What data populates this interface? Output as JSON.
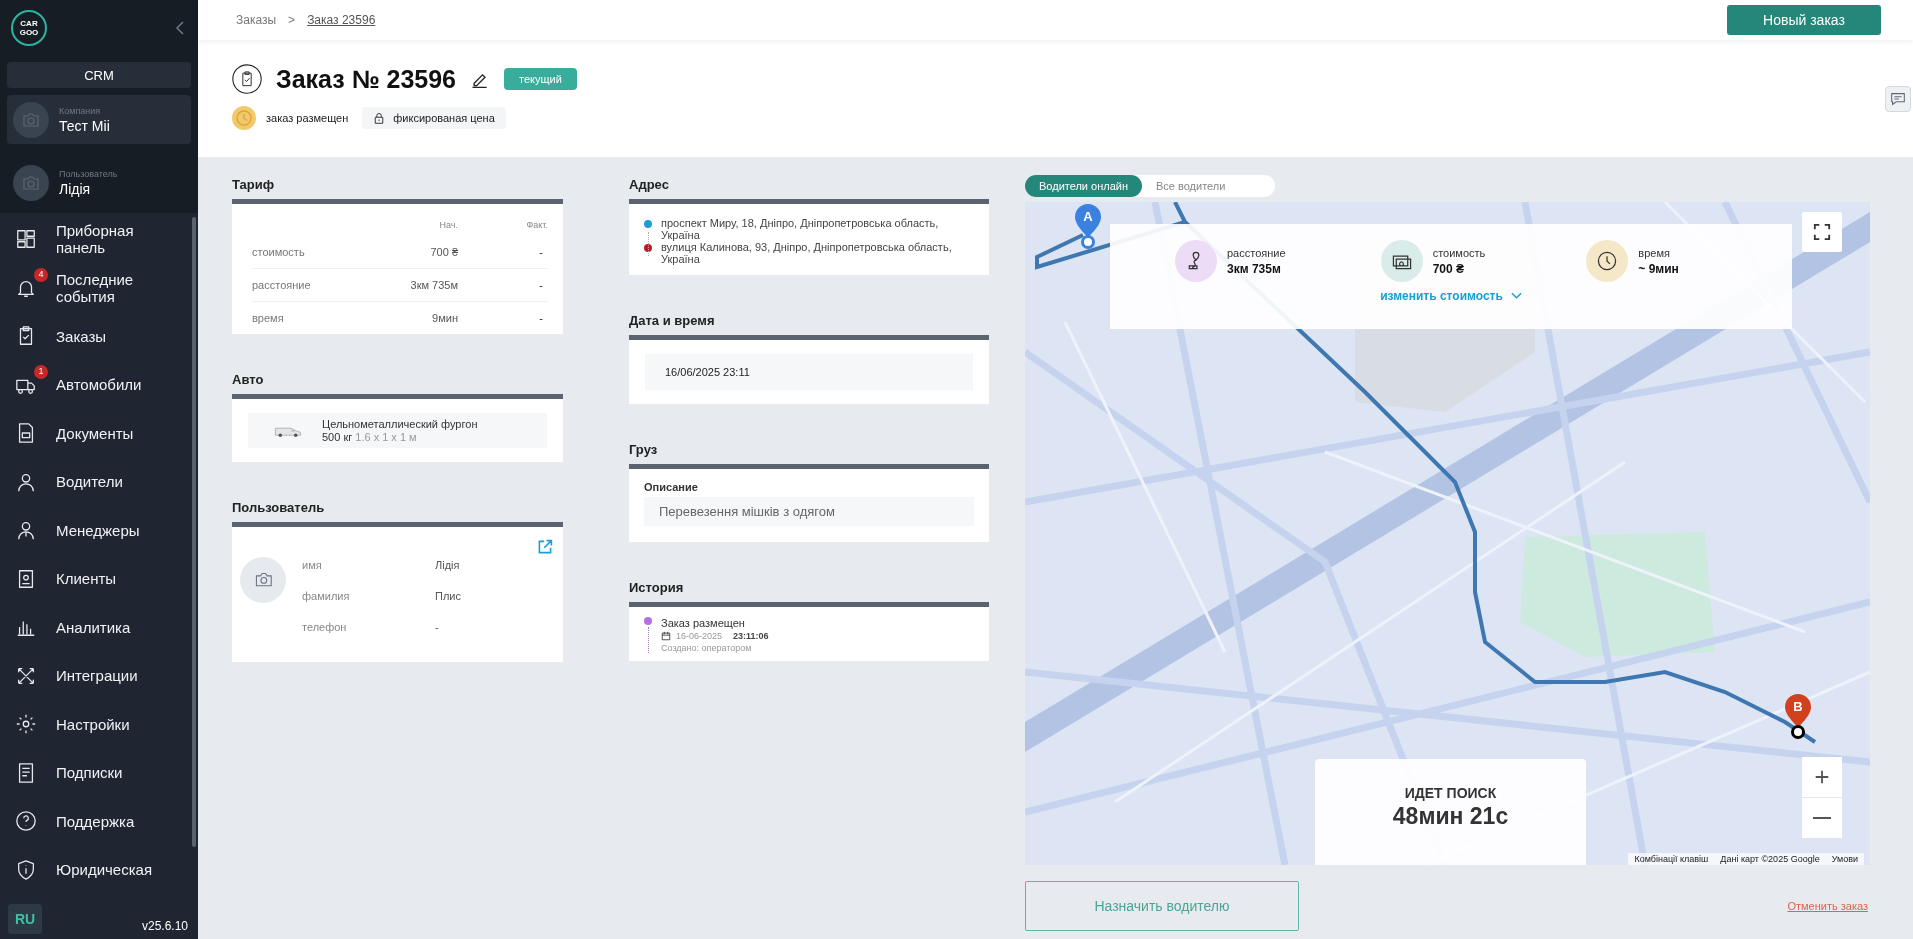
{
  "sidebar": {
    "logo_lines": [
      "CAR",
      "GOO"
    ],
    "section": "CRM",
    "company": {
      "label": "Компания",
      "name": "Тест Mii"
    },
    "user": {
      "label": "Пользователь",
      "name": "Лідія"
    },
    "items": [
      {
        "label": "Приборная панель"
      },
      {
        "label": "Последние события",
        "badge": "4"
      },
      {
        "label": "Заказы"
      },
      {
        "label": "Автомобили",
        "badge": "1"
      },
      {
        "label": "Документы"
      },
      {
        "label": "Водители"
      },
      {
        "label": "Менеджеры"
      },
      {
        "label": "Клиенты"
      },
      {
        "label": "Аналитика"
      },
      {
        "label": "Интеграции"
      },
      {
        "label": "Настройки"
      },
      {
        "label": "Подписки"
      },
      {
        "label": "Поддержка"
      },
      {
        "label": "Юридическая"
      }
    ],
    "language": "RU",
    "version": "v25.6.10"
  },
  "breadcrumbs": {
    "items": [
      {
        "label": "Заказы",
        "current": false
      },
      {
        "label": "Заказ 23596",
        "current": true
      }
    ],
    "separator": ">"
  },
  "new_order_button": "Новый заказ",
  "order": {
    "title": "Заказ № 23596",
    "status_badge": "текущий",
    "status": "заказ размещен",
    "price_type": "фиксированая цена"
  },
  "tariff": {
    "title": "Тариф",
    "columns": [
      "Нач.",
      "Факт."
    ],
    "rows": [
      {
        "label": "стоимость",
        "initial": "700 ₴",
        "actual": "-"
      },
      {
        "label": "расстояние",
        "initial": "3км 735м",
        "actual": "-"
      },
      {
        "label": "время",
        "initial": "9мин",
        "actual": "-"
      }
    ]
  },
  "auto": {
    "title": "Авто",
    "vehicle": "Цельнометаллический фургон",
    "capacity": "500 кг",
    "dimensions": "1.6 x 1 x 1 м"
  },
  "user_card": {
    "title": "Пользователь",
    "fields": [
      {
        "label": "имя",
        "value": "Лідія"
      },
      {
        "label": "фамилия",
        "value": "Плис"
      },
      {
        "label": "телефон",
        "value": "-"
      }
    ]
  },
  "address": {
    "title": "Адрес",
    "points": [
      {
        "text": "проспект Миру, 18, Дніпро, Дніпропетровська область, Україна",
        "color": "#1a9fd0"
      },
      {
        "text": "вулиця Калинова, 93, Дніпро, Дніпропетровська область, Україна",
        "color": "#b52025"
      }
    ]
  },
  "datetime": {
    "title": "Дата и время",
    "value": "16/06/2025 23:11"
  },
  "cargo": {
    "title": "Груз",
    "label": "Описание",
    "value": "Перевезення мішків з одягом"
  },
  "history": {
    "title": "История",
    "events": [
      {
        "title": "Заказ размещен",
        "date": "16-06-2025",
        "time": "23:11:06",
        "note": "Создано: оператором",
        "color": "#b36ee8"
      }
    ]
  },
  "map": {
    "tabs": [
      {
        "label": "Водители онлайн",
        "selected": true
      },
      {
        "label": "Все водители",
        "selected": false
      }
    ],
    "stats": [
      {
        "label": "расстояние",
        "value": "3км 735м",
        "color": "#ecdcf6"
      },
      {
        "label": "стоимость",
        "value": "700 ₴",
        "color": "#d9ece9"
      },
      {
        "label": "время",
        "value": "~ 9мин",
        "color": "#f5e8c8"
      }
    ],
    "change_price": "изменить стоимость",
    "markers": [
      {
        "label": "A",
        "color": "#3b82e0"
      },
      {
        "label": "B",
        "color": "#d2401f"
      }
    ],
    "search": {
      "title": "ИДЕТ ПОИСК",
      "elapsed": "48мин 21с"
    },
    "attribution": [
      "Комбінації клавіш",
      "Дані карт ©2025 Google",
      "Умови"
    ]
  },
  "assign_button": "Назначить водителю",
  "cancel_link": "Отменить заказ"
}
